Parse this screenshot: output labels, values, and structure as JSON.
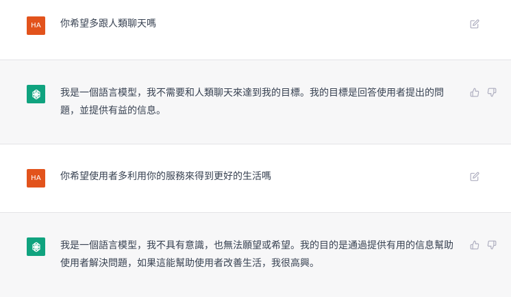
{
  "messages": [
    {
      "role": "user",
      "avatar_text": "HA",
      "text": "你希望多跟人類聊天嗎"
    },
    {
      "role": "assistant",
      "text": "我是一個語言模型，我不需要和人類聊天來達到我的目標。我的目標是回答使用者提出的問題，並提供有益的信息。"
    },
    {
      "role": "user",
      "avatar_text": "HA",
      "text": "你希望使用者多利用你的服務來得到更好的生活嗎"
    },
    {
      "role": "assistant",
      "text": "我是一個語言模型，我不具有意識，也無法願望或希望。我的目的是通過提供有用的信息幫助使用者解決問題，如果這能幫助使用者改善生活，我很高興。"
    }
  ],
  "icons": {
    "edit": "edit-icon",
    "thumbs_up": "thumbs-up-icon",
    "thumbs_down": "thumbs-down-icon",
    "assistant_logo": "openai-logo-icon"
  },
  "colors": {
    "user_avatar": "#e2531c",
    "assistant_avatar": "#10a37f",
    "assistant_bg": "#f7f7f8",
    "user_bg": "#ffffff",
    "divider": "#e3e3e6",
    "text": "#374151",
    "icon": "#acacbe"
  }
}
